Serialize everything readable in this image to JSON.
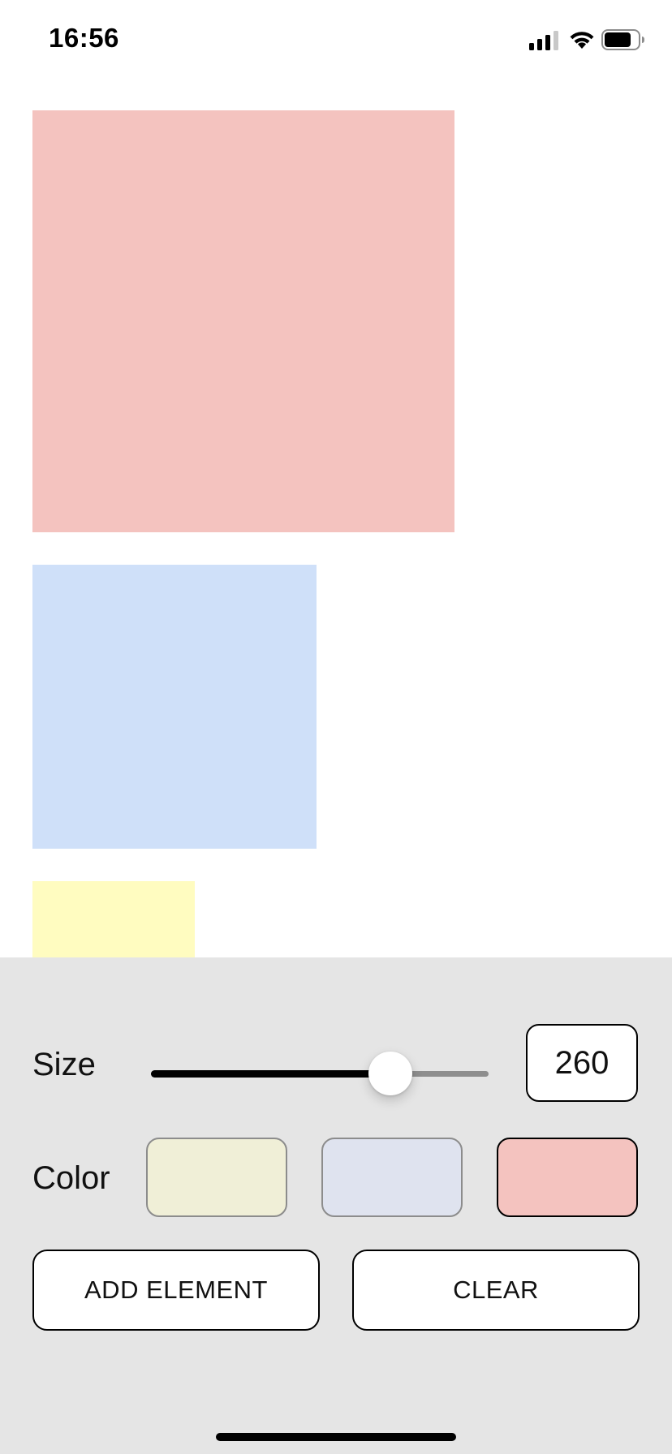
{
  "status_bar": {
    "time": "16:56",
    "icons": [
      "cellular-signal-icon",
      "wifi-icon",
      "battery-icon"
    ]
  },
  "canvas": {
    "elements": [
      {
        "color": "#f4c3bf",
        "size": 520
      },
      {
        "color": "#cfe0f9",
        "size": 350
      },
      {
        "color": "#fffcc0",
        "size": 200
      }
    ]
  },
  "controls": {
    "size_label": "Size",
    "size_value": "260",
    "slider_fraction": 0.71,
    "color_label": "Color",
    "swatches": [
      {
        "color": "#f0efd7",
        "selected": false
      },
      {
        "color": "#dfe3ef",
        "selected": false
      },
      {
        "color": "#f4c3bf",
        "selected": true
      }
    ],
    "add_button_label": "ADD ELEMENT",
    "clear_button_label": "CLEAR"
  },
  "colors": {
    "panel_background": "#e5e5e5",
    "accent": "#000000"
  }
}
